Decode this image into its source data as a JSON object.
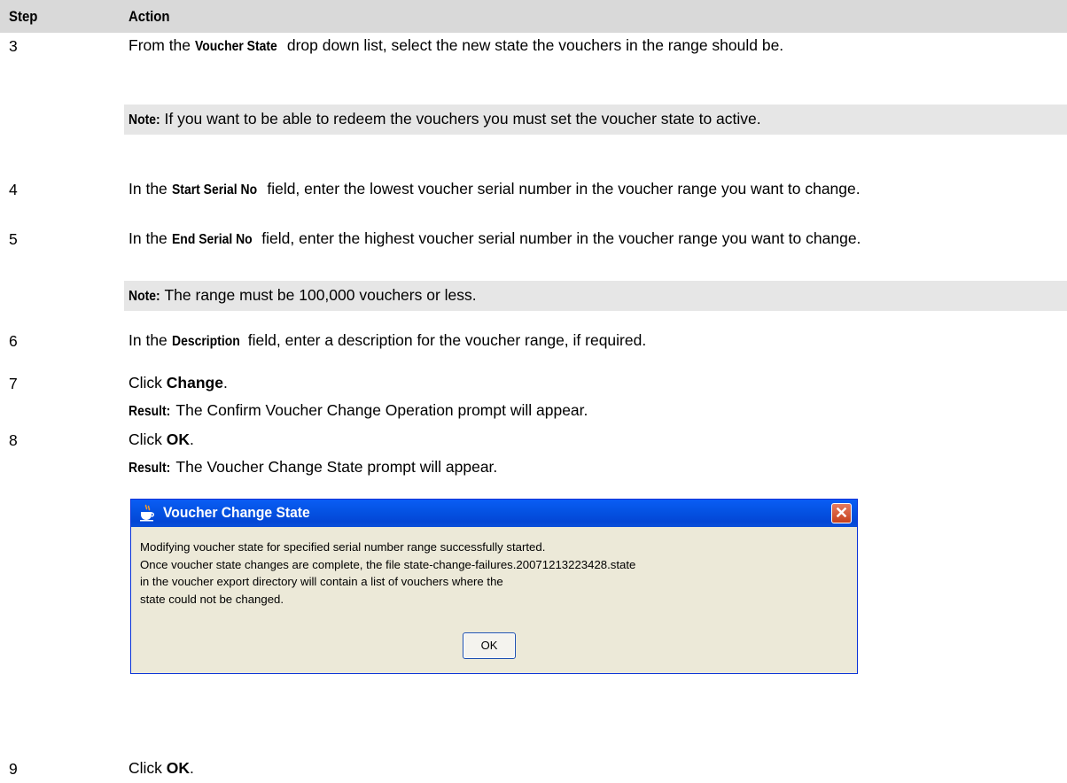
{
  "header": {
    "step": "Step",
    "action": "Action"
  },
  "rows": [
    {
      "num": "3",
      "pre": "From the ",
      "label": "Voucher State",
      "post": " drop down list, select the new state the vouchers in the range should be."
    },
    {
      "num": "4",
      "pre": "In the ",
      "label": "Start Serial No",
      "post": " field, enter the lowest voucher serial number in the voucher range you want to change."
    },
    {
      "num": "5",
      "pre": "In the ",
      "label": "End Serial No",
      "post": " field, enter the highest voucher serial number in the voucher range you want to change."
    },
    {
      "num": "6",
      "pre": "In the ",
      "label": "Description",
      "post": " field, enter a description for the voucher range, if required."
    },
    {
      "num": "7",
      "pre": "Click ",
      "bold": "Change",
      "post": "."
    },
    {
      "num": "8",
      "pre": "Click ",
      "bold": "OK",
      "post": "."
    },
    {
      "num": "9",
      "pre": "Click ",
      "bold": "OK",
      "post": "."
    }
  ],
  "notes": [
    {
      "label": "Note:",
      "text": "If you want to be able to redeem the vouchers you must set the voucher state to active."
    },
    {
      "label": "Note:",
      "text": "The range must be 100,000 vouchers or less."
    }
  ],
  "results": [
    {
      "label": "Result:",
      "text": "The Confirm Voucher Change Operation prompt will appear."
    },
    {
      "label": "Result:",
      "text": "The Voucher Change State prompt will appear."
    }
  ],
  "dialog": {
    "title": "Voucher Change State",
    "close_glyph": "✕",
    "lines": [
      "Modifying voucher state for specified serial number range successfully started.",
      "Once voucher state changes are complete, the file state-change-failures.20071213223428.state",
      "in the voucher export directory will contain a list of vouchers where the",
      "state could not be changed."
    ],
    "ok_label": "OK",
    "icon": "java-cup-icon"
  }
}
